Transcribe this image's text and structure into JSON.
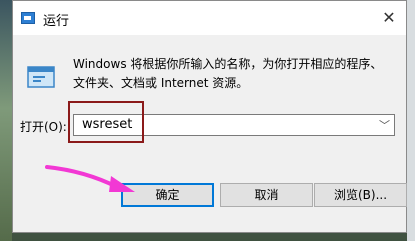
{
  "dialog": {
    "title": "运行",
    "description": "Windows 将根据你所输入的名称，为你打开相应的程序、文件夹、文档或 Internet 资源。",
    "open_label": "打开(O):",
    "input_value": "wsreset",
    "buttons": {
      "ok": "确定",
      "cancel": "取消",
      "browse": "浏览(B)..."
    }
  },
  "icons": {
    "title": "run-app-icon",
    "close": "close-icon",
    "run": "run-dialog-icon",
    "dropdown": "chevron-down-icon"
  },
  "colors": {
    "highlight_box": "#8b1a1a",
    "annotation_arrow": "#f238d4",
    "default_button_border": "#0078d7"
  }
}
